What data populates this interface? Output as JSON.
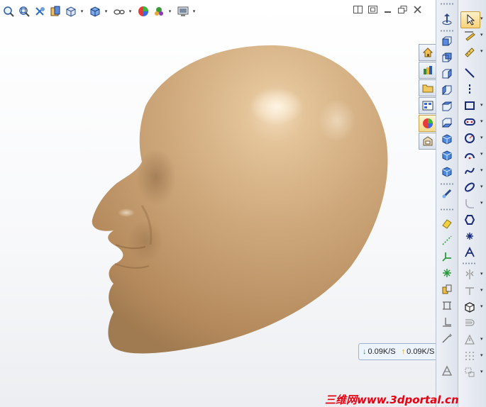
{
  "heads_up_toolbar": {
    "items": [
      {
        "name": "zoom-to-fit-icon",
        "has_dropdown": false
      },
      {
        "name": "zoom-to-area-icon",
        "has_dropdown": false
      },
      {
        "name": "previous-view-icon",
        "has_dropdown": false
      },
      {
        "name": "section-view-icon",
        "has_dropdown": false
      },
      {
        "name": "view-orientation-icon",
        "has_dropdown": true
      },
      {
        "name": "display-style-icon",
        "has_dropdown": true
      },
      {
        "name": "hide-show-items-icon",
        "has_dropdown": true
      },
      {
        "name": "edit-appearance-icon",
        "has_dropdown": false
      },
      {
        "name": "apply-scene-icon",
        "has_dropdown": true
      },
      {
        "name": "view-settings-icon",
        "has_dropdown": true
      }
    ]
  },
  "window_controls": [
    "tile-icon",
    "restore-icon",
    "minimize-icon",
    "maximize-icon",
    "close-icon"
  ],
  "task_pane": {
    "tabs": [
      "resources-home-icon",
      "design-library-icon",
      "file-explorer-icon",
      "view-palette-icon",
      "appearances-scenes-icon",
      "custom-properties-icon"
    ],
    "active_index": 4
  },
  "model": {
    "description_color": "#c9a67a"
  },
  "network_widget": {
    "download": "0.09K/S",
    "upload": "0.09K/S",
    "down_arrow": "↓",
    "up_arrow": "↑"
  },
  "watermark": "三维网www.3dportal.cn",
  "colors": {
    "accent": "#c99a3a",
    "model_skin": "#c9a67a",
    "watermark": "#e60012"
  }
}
